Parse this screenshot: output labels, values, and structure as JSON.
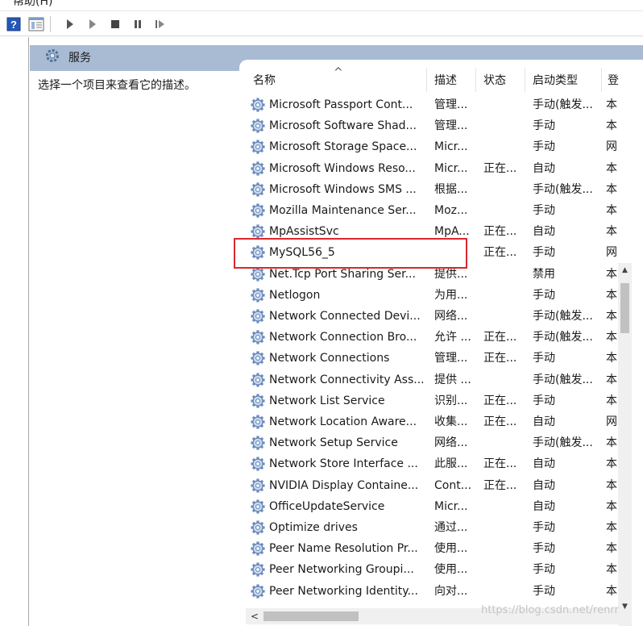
{
  "menubar": {
    "help_label": "帮助(H)"
  },
  "toolbar": {
    "buttons": [
      "help-icon",
      "show-hide-pane-icon",
      "start-icon",
      "start-outline-icon",
      "stop-icon",
      "pause-icon",
      "resume-icon"
    ]
  },
  "header": {
    "title": "服务"
  },
  "description": {
    "text": "选择一个项目来查看它的描述。"
  },
  "columns": {
    "name": "名称",
    "desc": "描述",
    "state": "状态",
    "start_type": "启动类型",
    "logon": "登"
  },
  "services": [
    {
      "name": "Microsoft Passport Cont...",
      "desc": "管理...",
      "state": "",
      "start_type": "手动(触发...",
      "logon": "本"
    },
    {
      "name": "Microsoft Software Shad...",
      "desc": "管理...",
      "state": "",
      "start_type": "手动",
      "logon": "本"
    },
    {
      "name": "Microsoft Storage Space...",
      "desc": "Micr...",
      "state": "",
      "start_type": "手动",
      "logon": "网"
    },
    {
      "name": "Microsoft Windows Reso...",
      "desc": "Micr...",
      "state": "正在...",
      "start_type": "自动",
      "logon": "本"
    },
    {
      "name": "Microsoft Windows SMS ...",
      "desc": "根据...",
      "state": "",
      "start_type": "手动(触发...",
      "logon": "本"
    },
    {
      "name": "Mozilla Maintenance Ser...",
      "desc": "Moz...",
      "state": "",
      "start_type": "手动",
      "logon": "本"
    },
    {
      "name": "MpAssistSvc",
      "desc": "MpA...",
      "state": "正在...",
      "start_type": "自动",
      "logon": "本"
    },
    {
      "name": "MySQL56_5",
      "desc": "",
      "state": "正在...",
      "start_type": "手动",
      "logon": "网"
    },
    {
      "name": "Net.Tcp Port Sharing Ser...",
      "desc": "提供...",
      "state": "",
      "start_type": "禁用",
      "logon": "本"
    },
    {
      "name": "Netlogon",
      "desc": "为用...",
      "state": "",
      "start_type": "手动",
      "logon": "本"
    },
    {
      "name": "Network Connected Devi...",
      "desc": "网络...",
      "state": "",
      "start_type": "手动(触发...",
      "logon": "本"
    },
    {
      "name": "Network Connection Bro...",
      "desc": "允许 ...",
      "state": "正在...",
      "start_type": "手动(触发...",
      "logon": "本"
    },
    {
      "name": "Network Connections",
      "desc": "管理...",
      "state": "正在...",
      "start_type": "手动",
      "logon": "本"
    },
    {
      "name": "Network Connectivity Ass...",
      "desc": "提供 ...",
      "state": "",
      "start_type": "手动(触发...",
      "logon": "本"
    },
    {
      "name": "Network List Service",
      "desc": "识别...",
      "state": "正在...",
      "start_type": "手动",
      "logon": "本"
    },
    {
      "name": "Network Location Aware...",
      "desc": "收集...",
      "state": "正在...",
      "start_type": "自动",
      "logon": "网"
    },
    {
      "name": "Network Setup Service",
      "desc": "网络...",
      "state": "",
      "start_type": "手动(触发...",
      "logon": "本"
    },
    {
      "name": "Network Store Interface ...",
      "desc": "此服...",
      "state": "正在...",
      "start_type": "自动",
      "logon": "本"
    },
    {
      "name": "NVIDIA Display Containe...",
      "desc": "Cont...",
      "state": "正在...",
      "start_type": "自动",
      "logon": "本"
    },
    {
      "name": "OfficeUpdateService",
      "desc": "Micr...",
      "state": "",
      "start_type": "自动",
      "logon": "本"
    },
    {
      "name": "Optimize drives",
      "desc": "通过...",
      "state": "",
      "start_type": "手动",
      "logon": "本"
    },
    {
      "name": "Peer Name Resolution Pr...",
      "desc": "使用...",
      "state": "",
      "start_type": "手动",
      "logon": "本"
    },
    {
      "name": "Peer Networking Groupi...",
      "desc": "使用...",
      "state": "",
      "start_type": "手动",
      "logon": "本"
    },
    {
      "name": "Peer Networking Identity...",
      "desc": "向对...",
      "state": "",
      "start_type": "手动",
      "logon": "本"
    }
  ],
  "selected_service": "MySQL56_5",
  "colors": {
    "header_band": "#a8bbd3",
    "highlight_border": "#d7282f",
    "gear_blue": "#5a7fb5"
  },
  "watermark": "https://blog.csdn.net/renrr"
}
